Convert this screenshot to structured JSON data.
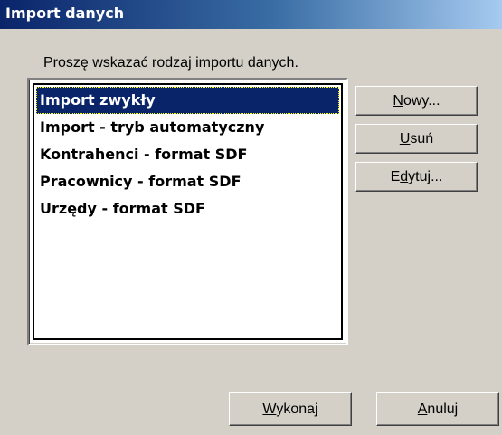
{
  "window": {
    "title": "Import danych"
  },
  "instruction": "Proszę wskazać rodzaj importu danych.",
  "list": {
    "items": [
      {
        "label": "Import zwykły",
        "selected": true
      },
      {
        "label": "Import - tryb automatyczny",
        "selected": false
      },
      {
        "label": "Kontrahenci - format SDF",
        "selected": false
      },
      {
        "label": "Pracownicy - format SDF",
        "selected": false
      },
      {
        "label": "Urzędy - format SDF",
        "selected": false
      }
    ]
  },
  "buttons": {
    "new": {
      "accel": "N",
      "rest": "owy..."
    },
    "delete": {
      "accel": "U",
      "rest": "suń"
    },
    "edit": {
      "pre": "E",
      "accel": "d",
      "rest": "ytuj..."
    },
    "execute": {
      "accel": "W",
      "rest": "ykonaj"
    },
    "cancel": {
      "accel": "A",
      "rest": "nuluj"
    }
  },
  "colors": {
    "title_bar": "#0a246a",
    "selection": "#0a246a",
    "dialog_bg": "#d4d0c8"
  }
}
